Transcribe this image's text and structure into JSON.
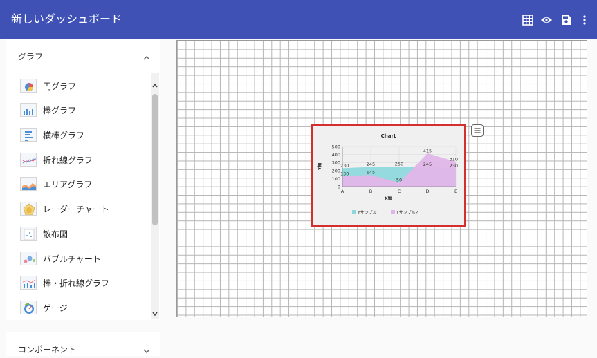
{
  "header": {
    "title": "新しいダッシュボード",
    "actions": [
      {
        "icon": "grid-icon"
      },
      {
        "icon": "eye-icon"
      },
      {
        "icon": "save-icon"
      },
      {
        "icon": "more-vert-icon"
      }
    ],
    "color": "#3f51b5"
  },
  "sidebar": {
    "graph_section": {
      "label": "グラフ",
      "expanded": true
    },
    "items": [
      {
        "label": "円グラフ",
        "icon": "pie-chart-icon"
      },
      {
        "label": "棒グラフ",
        "icon": "bar-chart-icon"
      },
      {
        "label": "横棒グラフ",
        "icon": "horizontal-bar-chart-icon"
      },
      {
        "label": "折れ線グラフ",
        "icon": "line-chart-icon"
      },
      {
        "label": "エリアグラフ",
        "icon": "area-chart-icon"
      },
      {
        "label": "レーダーチャート",
        "icon": "radar-chart-icon"
      },
      {
        "label": "散布図",
        "icon": "scatter-chart-icon"
      },
      {
        "label": "バブルチャート",
        "icon": "bubble-chart-icon"
      },
      {
        "label": "棒・折れ線グラフ",
        "icon": "bar-line-chart-icon"
      },
      {
        "label": "ゲージ",
        "icon": "gauge-icon"
      }
    ],
    "component_section": {
      "label": "コンポーネント",
      "expanded": false
    }
  },
  "widget": {
    "accent": "#d32f2f",
    "chart_data": {
      "type": "area",
      "title": "Chart",
      "xlabel": "X軸",
      "ylabel": "Y軸",
      "categories": [
        "A",
        "B",
        "C",
        "D",
        "E"
      ],
      "ylim": [
        0,
        500
      ],
      "yticks": [
        0,
        100,
        200,
        300,
        400,
        500
      ],
      "series": [
        {
          "name": "Yサンプル1",
          "values": [
            230,
            245,
            250,
            245,
            230
          ],
          "color": "#8ed8dc"
        },
        {
          "name": "Yサンプル2",
          "values": [
            130,
            145,
            50,
            415,
            310
          ],
          "color": "#e0b6e8"
        }
      ],
      "legend": "bottom"
    }
  }
}
